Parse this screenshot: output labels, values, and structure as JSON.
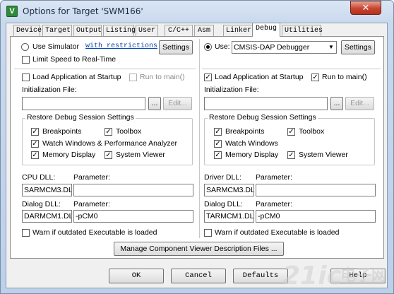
{
  "window": {
    "title": "Options for Target 'SWM166'",
    "icon_letter": "V",
    "close_glyph": "✕"
  },
  "tabs": [
    {
      "label": "Device"
    },
    {
      "label": "Target"
    },
    {
      "label": "Output"
    },
    {
      "label": "Listing"
    },
    {
      "label": "User"
    },
    {
      "label": "C/C++"
    },
    {
      "label": "Asm"
    },
    {
      "label": "Linker"
    },
    {
      "label": "Debug",
      "active": true
    },
    {
      "label": "Utilities"
    }
  ],
  "left": {
    "use_simulator": "Use Simulator",
    "restrictions_link": "with restrictions",
    "settings": "Settings",
    "limit_speed": "Limit Speed to Real-Time",
    "load_app": "Load Application at Startup",
    "run_to_main": "Run to main()",
    "init_file": "Initialization File:",
    "browse": "...",
    "edit": "Edit...",
    "restore_group": "Restore Debug Session Settings",
    "breakpoints": "Breakpoints",
    "toolbox": "Toolbox",
    "watch_windows": "Watch Windows & Performance Analyzer",
    "memory_display": "Memory Display",
    "system_viewer": "System Viewer",
    "cpu_dll": "CPU DLL:",
    "parameter": "Parameter:",
    "cpu_dll_value": "SARMCM3.DLL",
    "cpu_param_value": "",
    "dialog_dll": "Dialog DLL:",
    "dialog_dll_value": "DARMCM1.DLL",
    "dialog_param_value": "-pCM0",
    "warn_outdated": "Warn if outdated Executable is loaded"
  },
  "right": {
    "use": "Use:",
    "debugger": "CMSIS-DAP Debugger",
    "settings": "Settings",
    "load_app": "Load Application at Startup",
    "run_to_main": "Run to main()",
    "init_file": "Initialization File:",
    "browse": "...",
    "edit": "Edit...",
    "restore_group": "Restore Debug Session Settings",
    "breakpoints": "Breakpoints",
    "toolbox": "Toolbox",
    "watch_windows": "Watch Windows",
    "memory_display": "Memory Display",
    "system_viewer": "System Viewer",
    "driver_dll": "Driver DLL:",
    "parameter": "Parameter:",
    "driver_dll_value": "SARMCM3.DLL",
    "driver_param_value": "",
    "dialog_dll": "Dialog DLL:",
    "dialog_dll_value": "TARMCM1.DLL",
    "dialog_param_value": "-pCM0",
    "warn_outdated": "Warn if outdated Executable is loaded"
  },
  "manage_button": "Manage Component Viewer Description Files ...",
  "footer": {
    "ok": "OK",
    "cancel": "Cancel",
    "defaults": "Defaults",
    "help": "Help"
  },
  "watermark": {
    "brand": "21ic",
    "cn": "电子网"
  },
  "check_glyph": "✓"
}
